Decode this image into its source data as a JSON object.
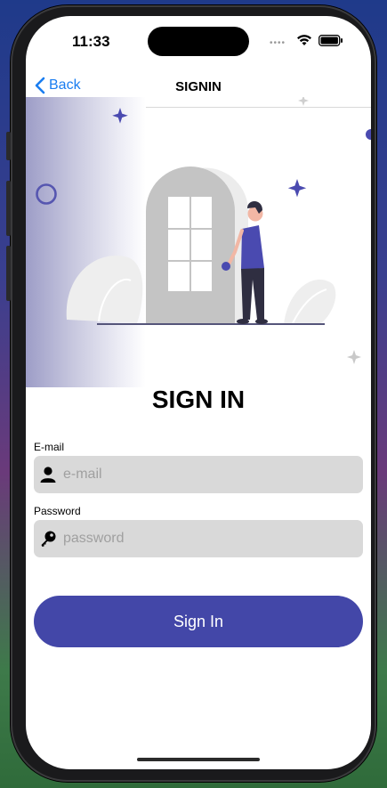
{
  "status_bar": {
    "time": "11:33",
    "signal_dots": "••••"
  },
  "nav": {
    "back_label": "Back",
    "title": "SIGNIN"
  },
  "page": {
    "heading": "SIGN IN"
  },
  "form": {
    "email": {
      "label": "E-mail",
      "placeholder": "e-mail",
      "value": ""
    },
    "password": {
      "label": "Password",
      "placeholder": "password",
      "value": ""
    },
    "submit_label": "Sign In"
  },
  "icons": {
    "back": "chevron-left-icon",
    "email": "person-icon",
    "password": "key-icon",
    "wifi": "wifi-icon",
    "battery": "battery-icon"
  },
  "colors": {
    "accent": "#4347a8",
    "link": "#1a7df0",
    "field_bg": "#d9d9d9",
    "illustration_purple": "#4a4ab0"
  }
}
